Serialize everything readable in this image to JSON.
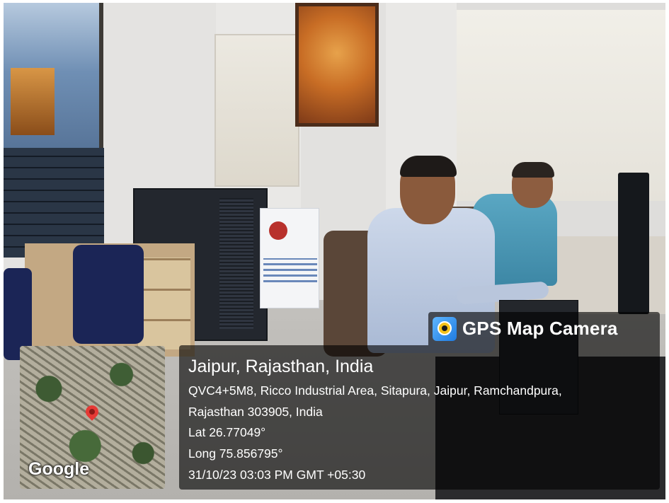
{
  "overlay": {
    "app_name": "GPS Map Camera",
    "location_title": "Jaipur, Rajasthan, India",
    "address_line1": "QVC4+5M8, Ricco Industrial Area, Sitapura, Jaipur, Ramchandpura,",
    "address_line2": "Rajasthan 303905, India",
    "latitude": "Lat 26.77049°",
    "longitude": "Long 75.856795°",
    "timestamp": "31/10/23 03:03 PM GMT +05:30",
    "map_brand": "Google"
  },
  "icons": {
    "app_icon": "gps-map-camera-icon",
    "map_marker": "map-pin-icon"
  },
  "colors": {
    "overlay_background": "#000000",
    "overlay_text": "#ffffff",
    "pin": "#e53935"
  }
}
